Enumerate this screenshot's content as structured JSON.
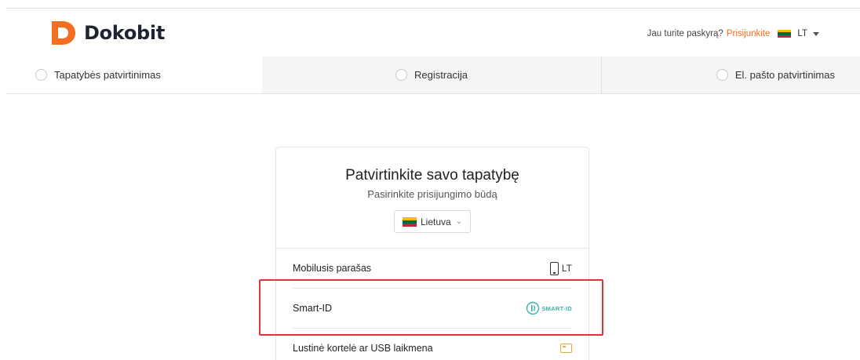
{
  "brand": {
    "name": "Dokobit",
    "logo_color": "#f26f21"
  },
  "account": {
    "prompt": "Jau turite paskyrą?",
    "login_link": "Prisijunkite",
    "language": "LT",
    "link_color": "#f26f21"
  },
  "flag_colors": [
    "#fdb913",
    "#006a44",
    "#c1272d"
  ],
  "steps": [
    {
      "label": "Tapatybės patvirtinimas",
      "active": true
    },
    {
      "label": "Registracija",
      "active": false
    },
    {
      "label": "El. pašto patvirtinimas",
      "active": false
    }
  ],
  "card": {
    "title": "Patvirtinkite savo tapatybę",
    "subtitle": "Pasirinkite prisijungimo būdą",
    "country_select": "Lietuva"
  },
  "methods": [
    {
      "label": "Mobilusis parašas",
      "badge": "LT",
      "icon": "mobile-phone-icon"
    },
    {
      "label": "Smart-ID",
      "badge": "SMART-ID",
      "icon": "smart-id-logo-icon"
    },
    {
      "label": "Lustinė kortelė ar USB laikmena",
      "badge": "",
      "icon": "smart-card-icon"
    }
  ],
  "annotation": {
    "highlight_color": "#e53237"
  }
}
